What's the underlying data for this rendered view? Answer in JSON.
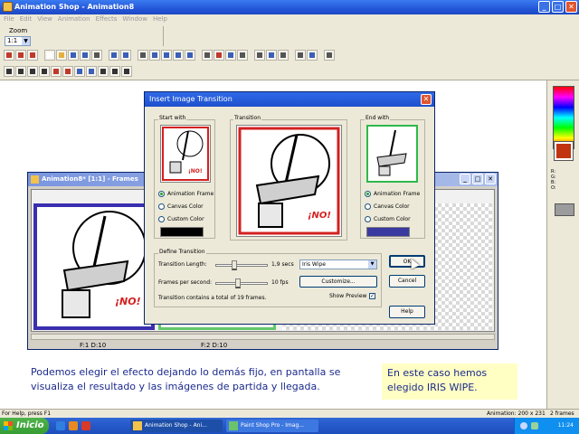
{
  "app": {
    "title": "Animation Shop - Animation8"
  },
  "menu": [
    "File",
    "Edit",
    "View",
    "Animation",
    "Effects",
    "Window",
    "Help"
  ],
  "zoom": {
    "label": "Zoom",
    "value": "1:1"
  },
  "frames_window": {
    "title": "Animation8* [1:1] - Frames",
    "frame_labels": [
      "F:1  D:10",
      "F:2  D:10"
    ]
  },
  "dialog": {
    "title": "Insert Image Transition",
    "start_group": "Start with",
    "transition_group": "Transition",
    "end_group": "End with",
    "start_options": [
      "Animation Frame",
      "Canvas Color",
      "Custom Color"
    ],
    "end_options": [
      "Animation Frame",
      "Canvas Color",
      "Custom Color"
    ],
    "start_selected": "Animation Frame",
    "end_selected": "Animation Frame",
    "start_custom_color": "#000000",
    "end_custom_color": "#3a3aa0",
    "define_group": "Define Transition",
    "length_label": "Transition Length:",
    "length_value": "1,9 secs",
    "fps_label": "Frames per second:",
    "fps_value": "10 fps",
    "effect_selected": "Iris Wipe",
    "customize_button": "Customize...",
    "show_preview_label": "Show Preview",
    "show_preview_checked": true,
    "summary": "Transition contains a total of 19 frames.",
    "ok_button": "OK",
    "cancel_button": "Cancel",
    "help_button": "Help",
    "preview_sign_text": "¡NO!"
  },
  "captions": {
    "left": "Podemos elegir el efecto dejando lo demás fijo, en pantalla se visualiza el resultado y las imágenes de partida y llegada.",
    "right": "En este caso hemos elegido IRIS WIPE."
  },
  "statusbar": {
    "help": "For Help, press F1",
    "animation": "Animation: 200 x 231",
    "frames": "2 frames"
  },
  "taskbar": {
    "start": "Inicio",
    "tasks": [
      "Animation Shop - Ani...",
      "Paint Shop Pro - Imag..."
    ],
    "clock": "11:24"
  }
}
